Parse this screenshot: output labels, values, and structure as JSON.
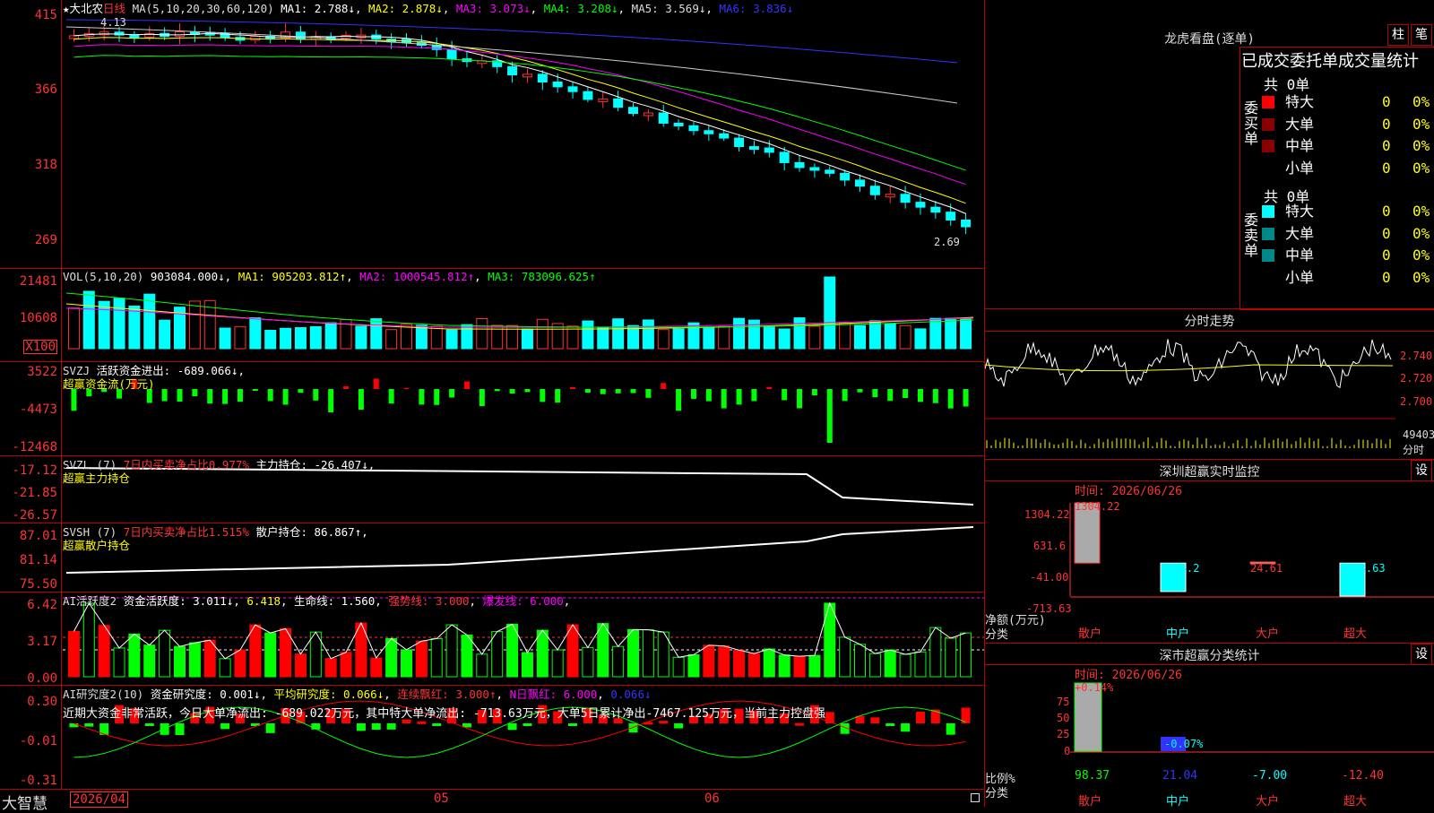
{
  "main": {
    "title": "★大北农",
    "period": "日线",
    "ma_spec": "MA(5,10,20,30,60,120)",
    "ma1": "MA1: 2.788↓",
    "ma2": "MA2: 2.878↓",
    "ma3": "MA3: 3.073↓",
    "ma4": "MA4: 3.208↓",
    "ma5": "MA5: 3.569↓",
    "ma6": "MA6: 3.836↓",
    "high_label": "4.13",
    "low_label": "2.69",
    "y_ticks": [
      "415",
      "366",
      "318",
      "269"
    ]
  },
  "vol": {
    "spec": "VOL(5,10,20)",
    "value": "903084.000↓",
    "ma1": "MA1: 905203.812↑",
    "ma2": "MA2: 1000545.812↑",
    "ma3": "MA3: 783096.625↑",
    "y_ticks": [
      "21481",
      "10608"
    ],
    "unit": "X100"
  },
  "svzj": {
    "spec": "SVZJ",
    "label": "活跃资金进出: -689.066↓",
    "line2": "超赢资金流(万元)",
    "y_ticks": [
      "3522",
      "-4473",
      "-12468"
    ]
  },
  "svzl": {
    "spec": "SVZL (7)",
    "ratio": "7日内买卖净占比0.977%",
    "holding": "主力持仓: -26.407↓,",
    "line2": "超赢主力持仓",
    "y_ticks": [
      "-17.12",
      "-21.85",
      "-26.57"
    ]
  },
  "svsh": {
    "spec": "SVSH (7)",
    "ratio": "7日内买卖净占比1.515%",
    "holding": "散户持仓: 86.867↑,",
    "line2": "超赢散户持仓",
    "y_ticks": [
      "87.01",
      "81.14",
      "75.50"
    ]
  },
  "ai_active": {
    "spec": "AI活跃度2",
    "active": "资金活跃度: 3.011↓",
    "val2": "6.418",
    "life": "生命线: 1.560",
    "strong": "强势线: 3.000",
    "burst": "爆发线: 6.000",
    "y_ticks": [
      "6.42",
      "3.17",
      "0.00"
    ]
  },
  "ai_research": {
    "spec": "AI研究度2(10)",
    "research": "资金研究度: 0.001↓",
    "avg": "平均研究度: 0.066↓",
    "red": "连续飘红: 3.000↑",
    "nday": "N日飘红: 6.000",
    "extra": "0.066↓",
    "summary": "近期大资金非常活跃，今日大单净流出: -689.022万元，其中特大单净流出: -713.63万元，大单5日累计净出-7467.125万元，当前主力控盘强",
    "y_ticks": [
      "0.30",
      "-0.01",
      "-0.31"
    ]
  },
  "bottom": {
    "brand": "大智慧",
    "date_start": "2026/04",
    "m05": "05",
    "m06": "06"
  },
  "dragon": {
    "title": "龙虎看盘(逐单)",
    "btn_bar": "柱",
    "btn_stroke": "笔",
    "header": "已成交委托单成交量统计",
    "buy_side": "委买单",
    "sell_side": "委卖单",
    "buy_total": "共 0单",
    "sell_total": "共 0单",
    "buy_rows": [
      {
        "name": "特大",
        "val": "0",
        "pct": "0%"
      },
      {
        "name": "大单",
        "val": "0",
        "pct": "0%"
      },
      {
        "name": "中单",
        "val": "0",
        "pct": "0%"
      },
      {
        "name": "小单",
        "val": "0",
        "pct": "0%"
      }
    ],
    "sell_rows": [
      {
        "name": "特大",
        "val": "0",
        "pct": "0%"
      },
      {
        "name": "大单",
        "val": "0",
        "pct": "0%"
      },
      {
        "name": "中单",
        "val": "0",
        "pct": "0%"
      },
      {
        "name": "小单",
        "val": "0",
        "pct": "0%"
      }
    ]
  },
  "minute": {
    "title": "分时走势",
    "p1": "2.740",
    "p2": "2.720",
    "p3": "2.700",
    "vol": "49403",
    "vol_label": "分时"
  },
  "monitor": {
    "title": "深圳超赢实时监控",
    "settings": "设",
    "time_label": "时间: 2026/06/26",
    "y_ticks": [
      "1304.22",
      "631.6",
      "-41.00",
      "-713.63"
    ],
    "axis_label_1": "净额(万元)",
    "axis_label_2": "分类",
    "bar_labels": [
      "1304.22",
      "-615.2",
      "24.61",
      "-713.63"
    ],
    "categories": [
      "散户",
      "中户",
      "大户",
      "超大"
    ]
  },
  "classify": {
    "title": "深市超赢分类统计",
    "settings": "设",
    "time_label": "时间: 2026/06/26",
    "top_label": "+0.14%",
    "mid_label": "-0.07%",
    "y_ticks": [
      "75",
      "50",
      "25",
      "0"
    ],
    "axis_label_1": "比例%",
    "axis_label_2": "分类",
    "values": [
      "98.37",
      "21.04",
      "-7.00",
      "-12.40"
    ],
    "categories": [
      "散户",
      "中户",
      "大户",
      "超大"
    ]
  },
  "chart_data": {
    "type": "bar",
    "title": "深圳超赢实时监控",
    "categories": [
      "散户",
      "中户",
      "大户",
      "超大"
    ],
    "values": [
      1304.22,
      -615.2,
      24.61,
      -713.63
    ],
    "ylabel": "净额(万元)",
    "ylim": [
      -713.63,
      1304.22
    ]
  }
}
